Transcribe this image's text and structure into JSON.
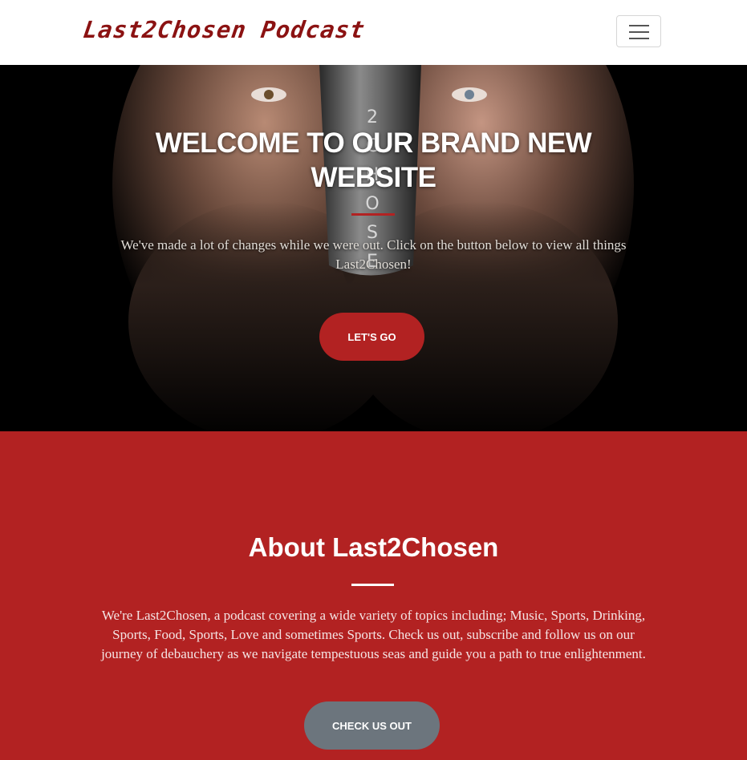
{
  "navbar": {
    "brand": "Last2Chosen Podcast",
    "toggle_icon": "hamburger-menu-icon"
  },
  "hero": {
    "title": "WELCOME TO OUR BRAND NEW WEBSITE",
    "text": "We've made a lot of changes while we were out. Click on the button below to view all things Last2Chosen!",
    "button_label": "LET'S GO",
    "mic_text": "2CHOSE"
  },
  "about": {
    "title": "About Last2Chosen",
    "text": "We're Last2Chosen, a podcast covering a wide variety of topics including; Music, Sports, Drinking, Sports, Food, Sports, Love and sometimes Sports. Check us out, subscribe and follow us on our journey of debauchery as we navigate tempestuous seas and guide you a path to true enlightenment.",
    "button_label": "CHECK US OUT"
  },
  "colors": {
    "accent": "#b22222",
    "brand": "#8b1212",
    "secondary_button": "#6c757d"
  }
}
